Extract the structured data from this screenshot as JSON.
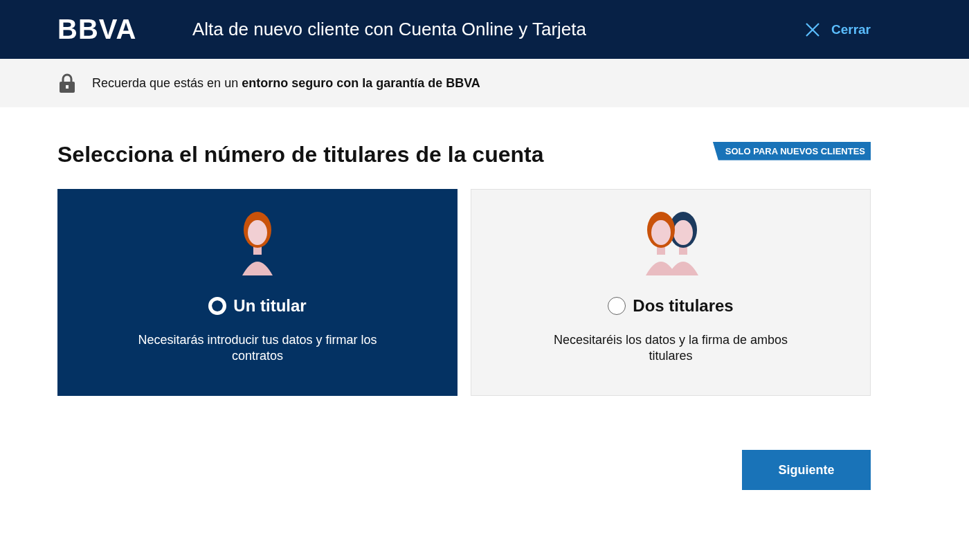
{
  "header": {
    "logo": "BBVA",
    "title": "Alta de nuevo cliente con Cuenta Online y Tarjeta",
    "close_label": "Cerrar"
  },
  "notice": {
    "text": "Recuerda que estás en un **entorno seguro con la garantía de BBVA**"
  },
  "heading": "Selecciona el número de titulares de la cuenta",
  "badge": "SOLO PARA NUEVOS CLIENTES",
  "options": [
    {
      "kind": "single",
      "label": "Un titular",
      "description": "Necesitarás introducir tus datos y firmar los contratos",
      "selected": true
    },
    {
      "kind": "double",
      "label": "Dos titulares",
      "description": "Necesitaréis los datos y la firma de ambos titulares",
      "selected": false
    }
  ],
  "next_button": "Siguiente"
}
